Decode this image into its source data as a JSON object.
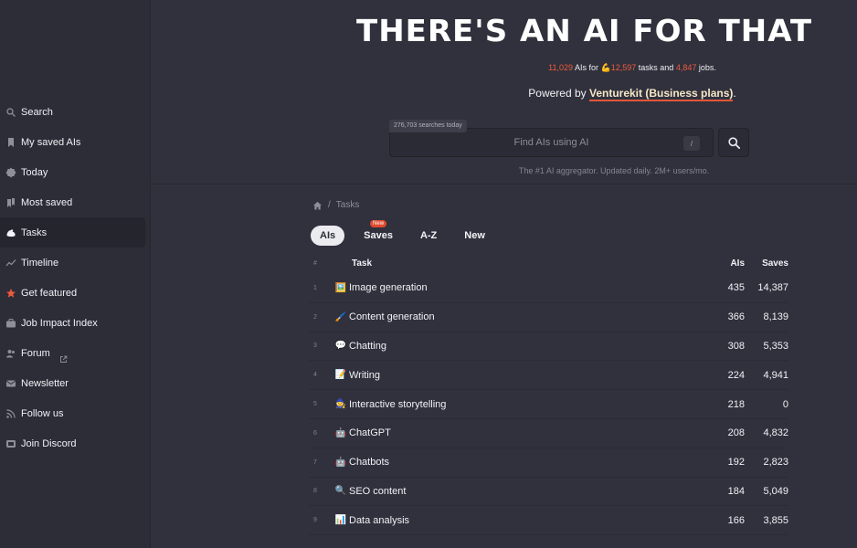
{
  "sidebar": {
    "items": [
      {
        "label": "Search",
        "icon": "search-icon"
      },
      {
        "label": "My saved AIs",
        "icon": "bookmark-icon"
      },
      {
        "label": "Today",
        "icon": "badge-icon"
      },
      {
        "label": "Most saved",
        "icon": "bookmarks-icon"
      },
      {
        "label": "Tasks",
        "icon": "flex-arm-icon"
      },
      {
        "label": "Timeline",
        "icon": "trend-line-icon"
      },
      {
        "label": "Get featured",
        "icon": "star-icon"
      },
      {
        "label": "Job Impact Index",
        "icon": "briefcase-icon"
      },
      {
        "label": "Forum",
        "icon": "users-icon"
      },
      {
        "label": "Newsletter",
        "icon": "mail-icon"
      },
      {
        "label": "Follow us",
        "icon": "rss-icon"
      },
      {
        "label": "Join Discord",
        "icon": "discord-icon"
      }
    ],
    "active_index": 4
  },
  "header": {
    "brand": "THERE'S AN AI FOR THAT",
    "stats": {
      "ais_count": "11,029",
      "ais_for": "AIs for",
      "tasks_count": "12,597",
      "tasks_and": "tasks and",
      "jobs_count": "4,847",
      "jobs_label": "jobs."
    },
    "powered_prefix": "Powered by",
    "powered_link": "Venturekit (Business plans)",
    "powered_suffix": ".",
    "search": {
      "count": "276,703 searches today",
      "placeholder": "Find AIs using AI",
      "shortcut": "/"
    },
    "tagline": "The #1 AI aggregator. Updated daily. 2M+ users/mo."
  },
  "breadcrumb": {
    "current": "Tasks",
    "separator": "/"
  },
  "tabs": [
    {
      "label": "AIs",
      "active": true
    },
    {
      "label": "Saves",
      "badge": "New"
    },
    {
      "label": "A-Z"
    },
    {
      "label": "New"
    }
  ],
  "table": {
    "headers": {
      "idx": "#",
      "task": "Task",
      "ais": "AIs",
      "saves": "Saves"
    },
    "rows": [
      {
        "idx": "1",
        "emoji": "🖼️",
        "task": "Image generation",
        "ais": "435",
        "saves": "14,387"
      },
      {
        "idx": "2",
        "emoji": "🖌️",
        "task": "Content generation",
        "ais": "366",
        "saves": "8,139"
      },
      {
        "idx": "3",
        "emoji": "💬",
        "task": "Chatting",
        "ais": "308",
        "saves": "5,353"
      },
      {
        "idx": "4",
        "emoji": "📝",
        "task": "Writing",
        "ais": "224",
        "saves": "4,941"
      },
      {
        "idx": "5",
        "emoji": "🧙",
        "task": "Interactive storytelling",
        "ais": "218",
        "saves": "0"
      },
      {
        "idx": "6",
        "emoji": "🤖",
        "task": "ChatGPT",
        "ais": "208",
        "saves": "4,832"
      },
      {
        "idx": "7",
        "emoji": "🤖",
        "task": "Chatbots",
        "ais": "192",
        "saves": "2,823"
      },
      {
        "idx": "8",
        "emoji": "🔍",
        "task": "SEO content",
        "ais": "184",
        "saves": "5,049"
      },
      {
        "idx": "9",
        "emoji": "📊",
        "task": "Data analysis",
        "ais": "166",
        "saves": "3,855"
      }
    ]
  },
  "colors": {
    "accent": "#ef5a3c",
    "background": "#31313d",
    "sidebar": "#2d2d38",
    "link": "#f6e7c6"
  }
}
